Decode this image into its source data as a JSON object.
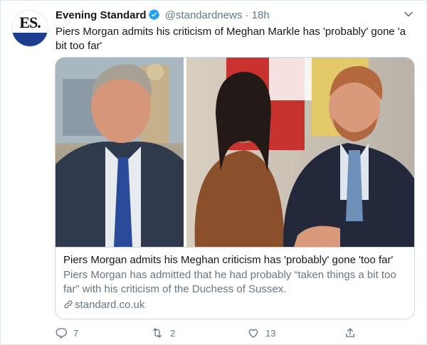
{
  "tweet": {
    "author_name": "Evening Standard",
    "handle": "@standardnews",
    "separator": "·",
    "time": "18h",
    "text": "Piers Morgan admits his criticism of Meghan Markle has 'probably' gone 'a bit too far'",
    "avatar_text": "ES."
  },
  "card": {
    "title": "Piers Morgan admits his Meghan criticism has 'probably' gone 'too far'",
    "description": "Piers Morgan has admitted that he had probably “taken things a bit too far” with his criticism of the Duchess of Sussex.",
    "domain": "standard.co.uk"
  },
  "actions": {
    "replies": "7",
    "retweets": "2",
    "likes": "13"
  },
  "colors": {
    "verified": "#1da1f2",
    "secondary_text": "#657786",
    "avatar_band": "#1d3d8f"
  }
}
